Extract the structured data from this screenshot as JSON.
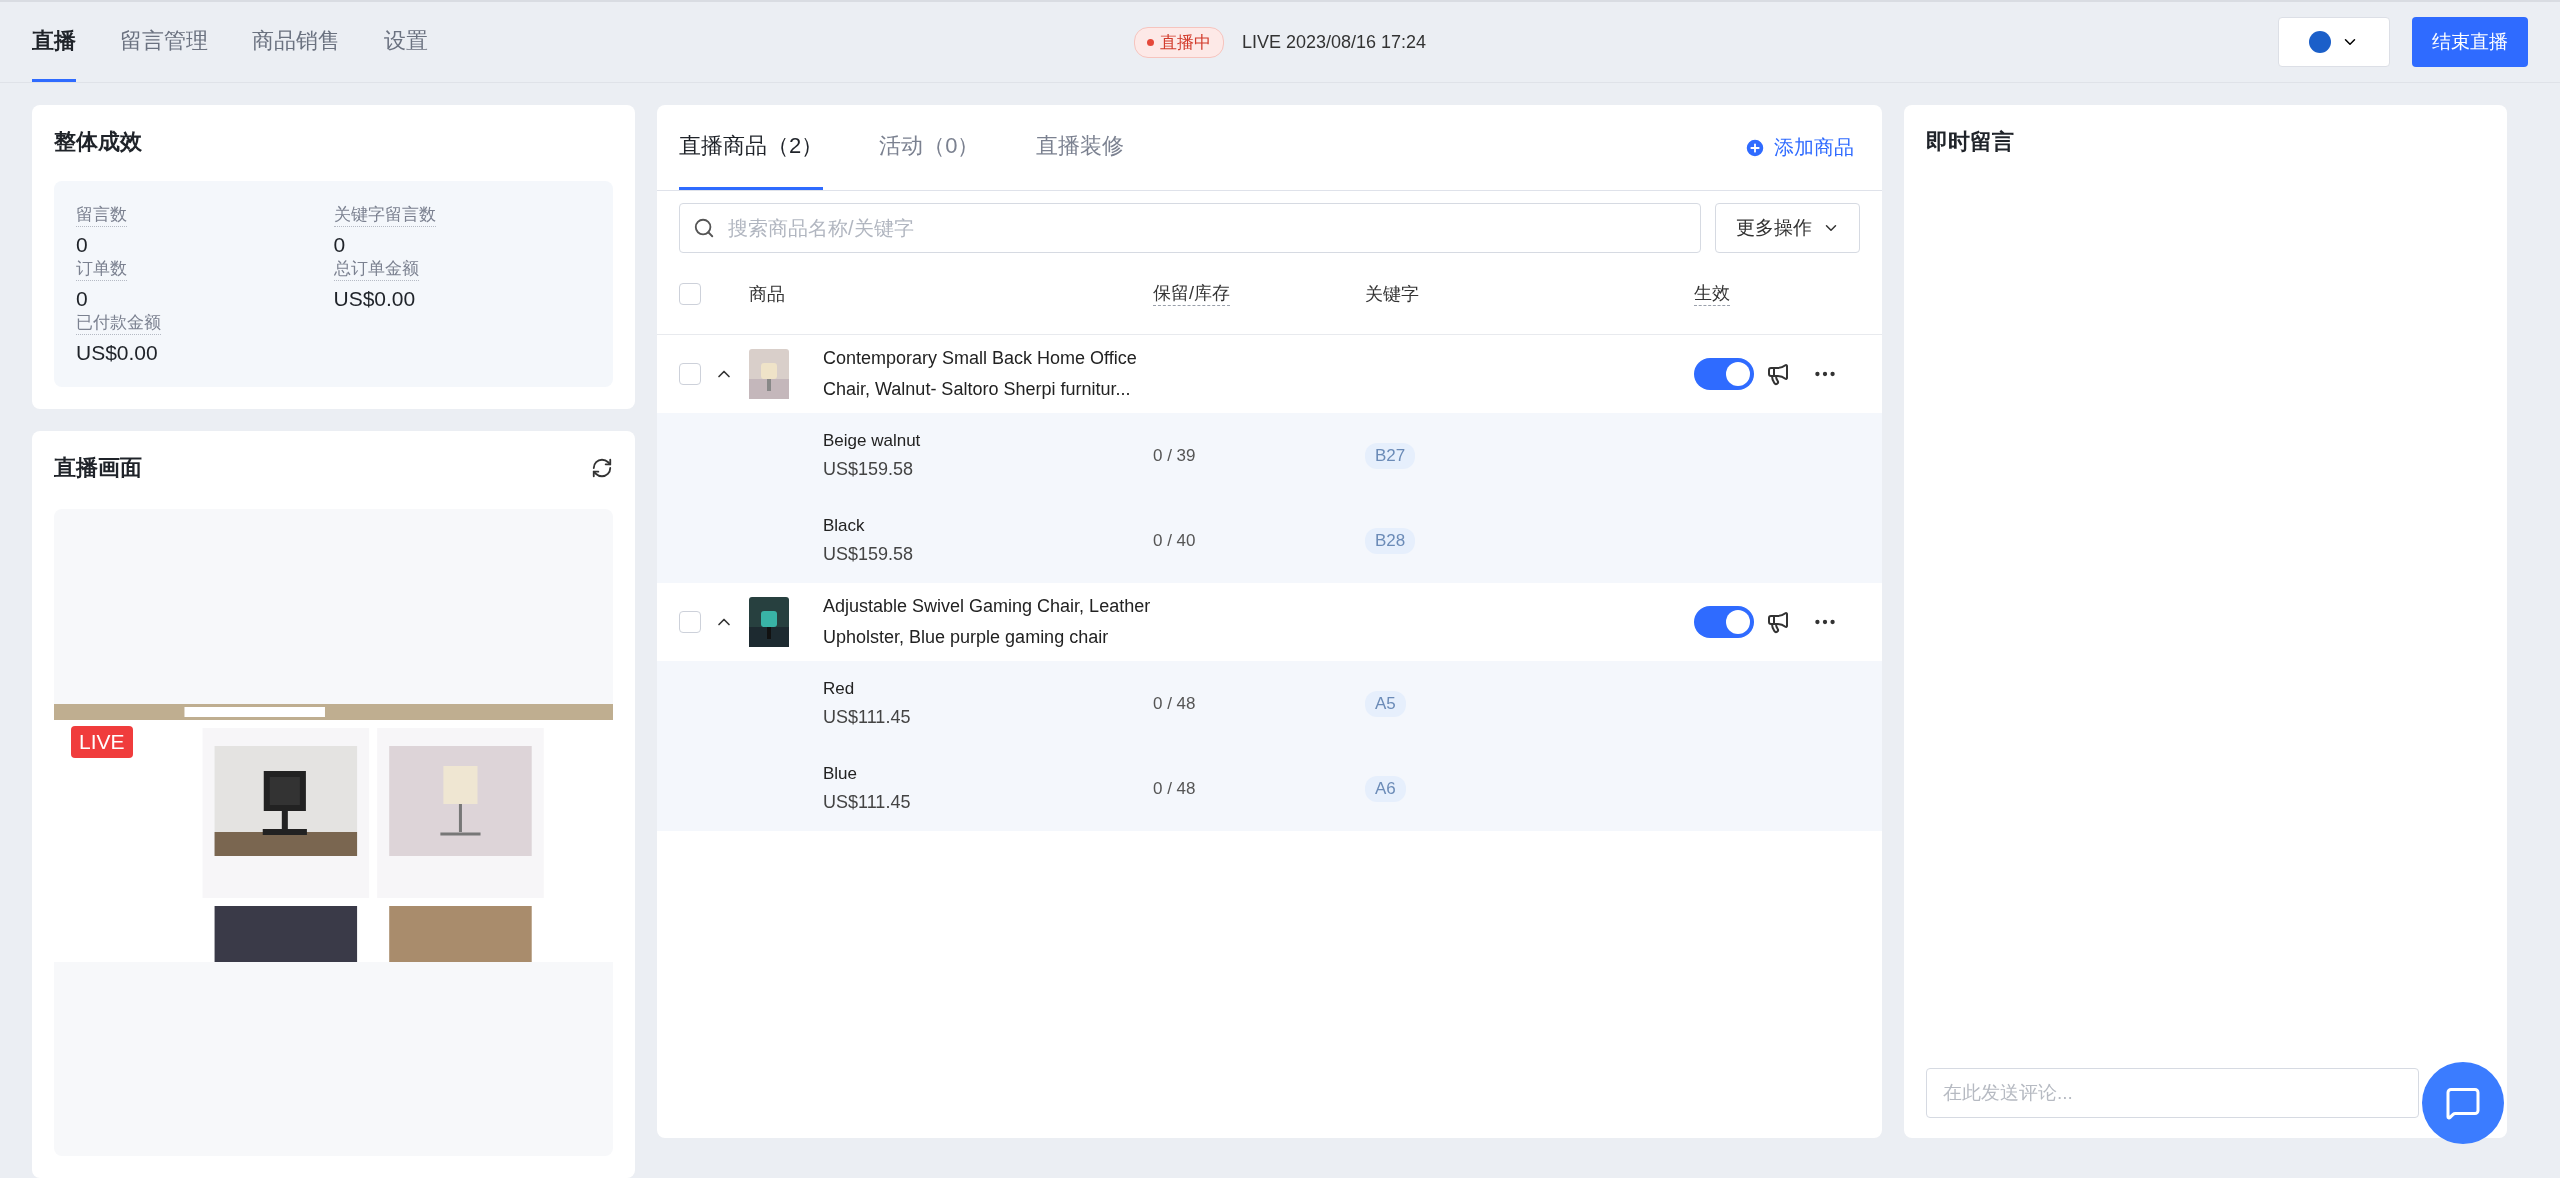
{
  "nav": {
    "tabs": [
      {
        "label": "直播",
        "selected": true
      },
      {
        "label": "留言管理",
        "selected": false
      },
      {
        "label": "商品销售",
        "selected": false
      },
      {
        "label": "设置",
        "selected": false
      }
    ]
  },
  "status": {
    "badge": "直播中",
    "live_label": "LIVE 2023/08/16 17:24"
  },
  "end_button": "结束直播",
  "performance": {
    "title": "整体成效",
    "stats": [
      {
        "label": "留言数",
        "value": "0"
      },
      {
        "label": "关键字留言数",
        "value": "0"
      },
      {
        "label": "订单数",
        "value": "0"
      },
      {
        "label": "总订单金额",
        "value": "US$0.00"
      },
      {
        "label": "已付款金额",
        "value": "US$0.00"
      }
    ]
  },
  "stream": {
    "title": "直播画面",
    "live_badge": "LIVE"
  },
  "products": {
    "tabs": [
      {
        "label": "直播商品（2）",
        "selected": true
      },
      {
        "label": "活动（0）",
        "selected": false
      },
      {
        "label": "直播装修",
        "selected": false
      }
    ],
    "add_label": "添加商品",
    "search": {
      "placeholder": "搜索商品名称/关键字"
    },
    "more_button": "更多操作",
    "select_all_checked": false,
    "columns": [
      {
        "label": "商品",
        "has_tooltip": false
      },
      {
        "label": "保留/库存",
        "has_tooltip": true
      },
      {
        "label": "关键字",
        "has_tooltip": false
      },
      {
        "label": "生效",
        "has_tooltip": true
      }
    ],
    "rows": [
      {
        "name": "Contemporary Small Back Home Office Chair, Walnut- Saltoro Sherpi furnitur...",
        "checked": false,
        "expanded": true,
        "on": true,
        "variants": [
          {
            "name": "Beige walnut",
            "price": "US$159.58",
            "stock": "0 / 39",
            "keyword": "B27"
          },
          {
            "name": "Black",
            "price": "US$159.58",
            "stock": "0 / 40",
            "keyword": "B28"
          }
        ]
      },
      {
        "name": "Adjustable Swivel Gaming Chair, Leather Upholster, Blue purple gaming chair",
        "checked": false,
        "expanded": true,
        "on": true,
        "variants": [
          {
            "name": "Red",
            "price": "US$111.45",
            "stock": "0 / 48",
            "keyword": "A5"
          },
          {
            "name": "Blue",
            "price": "US$111.45",
            "stock": "0 / 48",
            "keyword": "A6"
          }
        ]
      }
    ]
  },
  "comments": {
    "title": "即时留言",
    "input": {
      "placeholder": "在此发送评论..."
    }
  }
}
